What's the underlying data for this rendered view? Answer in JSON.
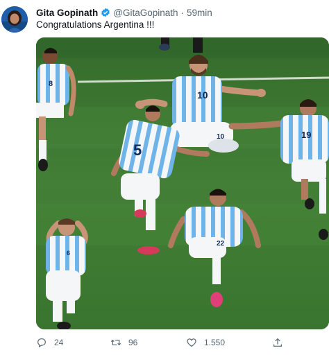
{
  "tweet": {
    "author_name": "Gita Gopinath",
    "handle": "@GitaGopinath",
    "separator": "·",
    "time": "59min",
    "text": "Congratulations Argentina !!!"
  },
  "players": [
    {
      "number": "8"
    },
    {
      "number": "10"
    },
    {
      "number": "19"
    },
    {
      "number": "5"
    },
    {
      "number": "22"
    },
    {
      "number": "6"
    }
  ],
  "actions": {
    "replies": "24",
    "retweets": "96",
    "likes": "1.550"
  },
  "colors": {
    "pitch": "#3d7a32",
    "shirt_blue": "#6fb4e8",
    "shirt_white": "#f4f6f8",
    "verified": "#1d9bf0",
    "muted": "#536471"
  },
  "icons": [
    "verified-badge-icon",
    "more-icon",
    "reply-icon",
    "retweet-icon",
    "like-icon",
    "share-icon"
  ]
}
